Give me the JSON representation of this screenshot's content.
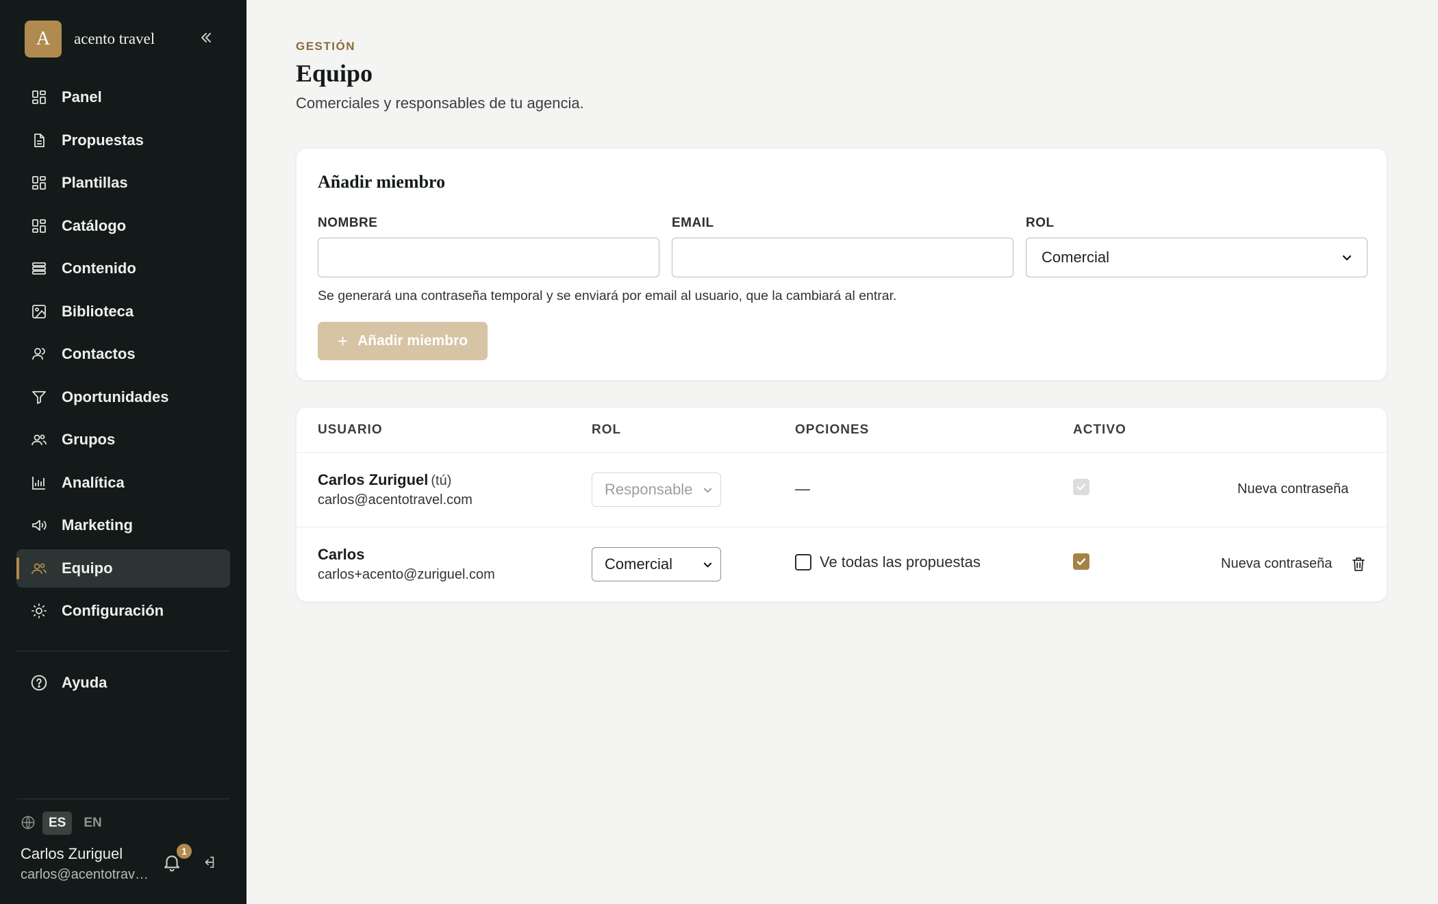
{
  "brand": {
    "logo_letter": "A",
    "name": "acento travel"
  },
  "sidebar": {
    "items": [
      {
        "label": "Panel",
        "icon": "grid-icon"
      },
      {
        "label": "Propuestas",
        "icon": "document-icon"
      },
      {
        "label": "Plantillas",
        "icon": "grid-icon"
      },
      {
        "label": "Catálogo",
        "icon": "grid-icon"
      },
      {
        "label": "Contenido",
        "icon": "stack-icon"
      },
      {
        "label": "Biblioteca",
        "icon": "image-icon"
      },
      {
        "label": "Contactos",
        "icon": "users-icon"
      },
      {
        "label": "Oportunidades",
        "icon": "filter-icon"
      },
      {
        "label": "Grupos",
        "icon": "group-icon"
      },
      {
        "label": "Analítica",
        "icon": "bar-chart-icon"
      },
      {
        "label": "Marketing",
        "icon": "megaphone-icon"
      },
      {
        "label": "Equipo",
        "icon": "team-icon",
        "active": true
      },
      {
        "label": "Configuración",
        "icon": "sun-icon"
      }
    ],
    "help_label": "Ayuda",
    "languages": [
      "ES",
      "EN"
    ],
    "active_language": "ES",
    "user_name": "Carlos Zuriguel",
    "user_email": "carlos@acentotravel.com",
    "notification_count": "1"
  },
  "page": {
    "eyebrow": "GESTIÓN",
    "title": "Equipo",
    "subtitle": "Comerciales y responsables de tu agencia."
  },
  "add_member": {
    "title": "Añadir miembro",
    "name_label": "NOMBRE",
    "name_value": "",
    "email_label": "EMAIL",
    "email_value": "",
    "role_label": "ROL",
    "role_value": "Comercial",
    "hint": "Se generará una contraseña temporal y se enviará por email al usuario, que la cambiará al entrar.",
    "button_label": "Añadir miembro"
  },
  "team_table": {
    "headers": {
      "user": "USUARIO",
      "role": "ROL",
      "options": "OPCIONES",
      "active": "ACTIVO"
    },
    "rows": [
      {
        "name": "Carlos Zuriguel",
        "you_tag": "(tú)",
        "email": "carlos@acentotravel.com",
        "role": "Responsable",
        "options": "—",
        "active": true,
        "reset_password": "Nueva contraseña"
      },
      {
        "name": "Carlos",
        "email": "carlos+acento@zuriguel.com",
        "role": "Comercial",
        "option_label": "Ve todas las propuestas",
        "option_checked": false,
        "active": true,
        "reset_password": "Nueva contraseña"
      }
    ]
  },
  "colors": {
    "sidebar_bg": "#131a19",
    "accent": "#b08a4e",
    "page_bg": "#f4f5f3"
  }
}
